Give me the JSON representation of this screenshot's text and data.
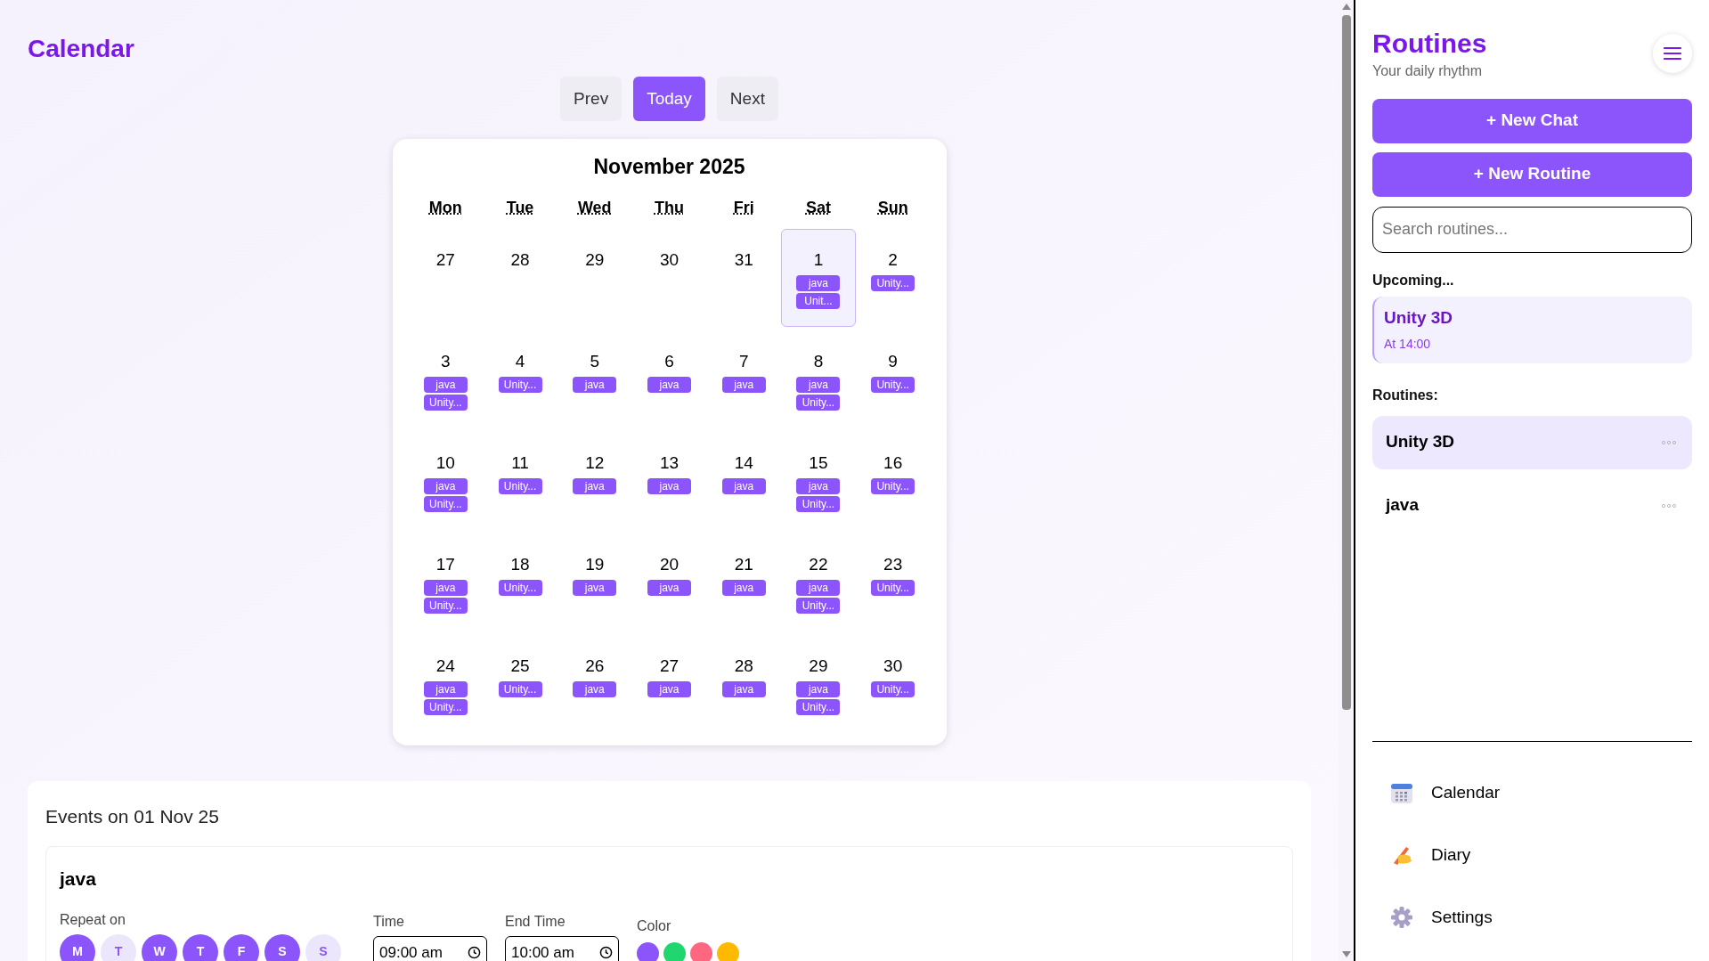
{
  "page_title": "Calendar",
  "nav": [
    {
      "label": "Prev",
      "selected": false
    },
    {
      "label": "Today",
      "selected": true
    },
    {
      "label": "Next",
      "selected": false
    }
  ],
  "calendar": {
    "month": "November 2025",
    "weekdays": [
      "Mon",
      "Tue",
      "Wed",
      "Thu",
      "Fri",
      "Sat",
      "Sun"
    ],
    "weeks": [
      [
        {
          "day": "27",
          "selected": false
        },
        {
          "day": "28",
          "selected": false
        },
        {
          "day": "29",
          "selected": false
        },
        {
          "day": "30",
          "selected": false
        },
        {
          "day": "31",
          "selected": false
        },
        {
          "day": "1",
          "selected": true,
          "events": [
            "java",
            "Unit..."
          ]
        },
        {
          "day": "2",
          "selected": false,
          "events": [
            "Unity..."
          ]
        }
      ],
      [
        {
          "day": "3",
          "selected": false,
          "events": [
            "java",
            "Unity..."
          ]
        },
        {
          "day": "4",
          "selected": false,
          "events": [
            "Unity..."
          ]
        },
        {
          "day": "5",
          "selected": false,
          "events": [
            "java"
          ]
        },
        {
          "day": "6",
          "selected": false,
          "events": [
            "java"
          ]
        },
        {
          "day": "7",
          "selected": false,
          "events": [
            "java"
          ]
        },
        {
          "day": "8",
          "selected": false,
          "events": [
            "java",
            "Unity..."
          ]
        },
        {
          "day": "9",
          "selected": false,
          "events": [
            "Unity..."
          ]
        }
      ],
      [
        {
          "day": "10",
          "selected": false,
          "events": [
            "java",
            "Unity..."
          ]
        },
        {
          "day": "11",
          "selected": false,
          "events": [
            "Unity..."
          ]
        },
        {
          "day": "12",
          "selected": false,
          "events": [
            "java"
          ]
        },
        {
          "day": "13",
          "selected": false,
          "events": [
            "java"
          ]
        },
        {
          "day": "14",
          "selected": false,
          "events": [
            "java"
          ]
        },
        {
          "day": "15",
          "selected": false,
          "events": [
            "java",
            "Unity..."
          ]
        },
        {
          "day": "16",
          "selected": false,
          "events": [
            "Unity..."
          ]
        }
      ],
      [
        {
          "day": "17",
          "selected": false,
          "events": [
            "java",
            "Unity..."
          ]
        },
        {
          "day": "18",
          "selected": false,
          "events": [
            "Unity..."
          ]
        },
        {
          "day": "19",
          "selected": false,
          "events": [
            "java"
          ]
        },
        {
          "day": "20",
          "selected": false,
          "events": [
            "java"
          ]
        },
        {
          "day": "21",
          "selected": false,
          "events": [
            "java"
          ]
        },
        {
          "day": "22",
          "selected": false,
          "events": [
            "java",
            "Unity..."
          ]
        },
        {
          "day": "23",
          "selected": false,
          "events": [
            "Unity..."
          ]
        }
      ],
      [
        {
          "day": "24",
          "selected": false,
          "events": [
            "java",
            "Unity..."
          ]
        },
        {
          "day": "25",
          "selected": false,
          "events": [
            "Unity..."
          ]
        },
        {
          "day": "26",
          "selected": false,
          "events": [
            "java"
          ]
        },
        {
          "day": "27",
          "selected": false,
          "events": [
            "java"
          ]
        },
        {
          "day": "28",
          "selected": false,
          "events": [
            "java"
          ]
        },
        {
          "day": "29",
          "selected": false,
          "events": [
            "java",
            "Unity..."
          ]
        },
        {
          "day": "30",
          "selected": false,
          "events": [
            "Unity..."
          ]
        }
      ]
    ]
  },
  "events_panel": {
    "title": "Events on 01 Nov 25",
    "event": {
      "name": "java",
      "repeat_label": "Repeat on",
      "repeat_days": [
        {
          "label": "M",
          "selected": true
        },
        {
          "label": "T",
          "selected": false
        },
        {
          "label": "W",
          "selected": true
        },
        {
          "label": "T",
          "selected": true
        },
        {
          "label": "F",
          "selected": true
        },
        {
          "label": "S",
          "selected": true
        },
        {
          "label": "S",
          "selected": false
        }
      ],
      "time_label": "Time",
      "time": "09:00 am",
      "end_time_label": "End Time",
      "end_time": "10:00 am",
      "color_label": "Color",
      "colors": [
        {
          "color": "#8b55fb"
        },
        {
          "color": "#1fd66f"
        },
        {
          "color": "#ff6680"
        },
        {
          "color": "#ffb900"
        }
      ]
    }
  },
  "sidebar": {
    "title": "Routines",
    "subtitle": "Your daily rhythm",
    "buttons": [
      "+ New Chat",
      "+ New Routine"
    ],
    "search": {
      "placeholder": "Search routines..."
    },
    "upcoming_label": "Upcoming...",
    "upcoming": {
      "name": "Unity 3D",
      "time": "At 14:00"
    },
    "routines_label": "Routines:",
    "routines": [
      {
        "name": "Unity 3D",
        "selected": true
      },
      {
        "name": "java",
        "selected": false
      }
    ],
    "nav": [
      {
        "kind": "calendar",
        "label": "Calendar"
      },
      {
        "kind": "diary",
        "label": "Diary"
      },
      {
        "kind": "settings",
        "label": "Settings"
      }
    ]
  }
}
